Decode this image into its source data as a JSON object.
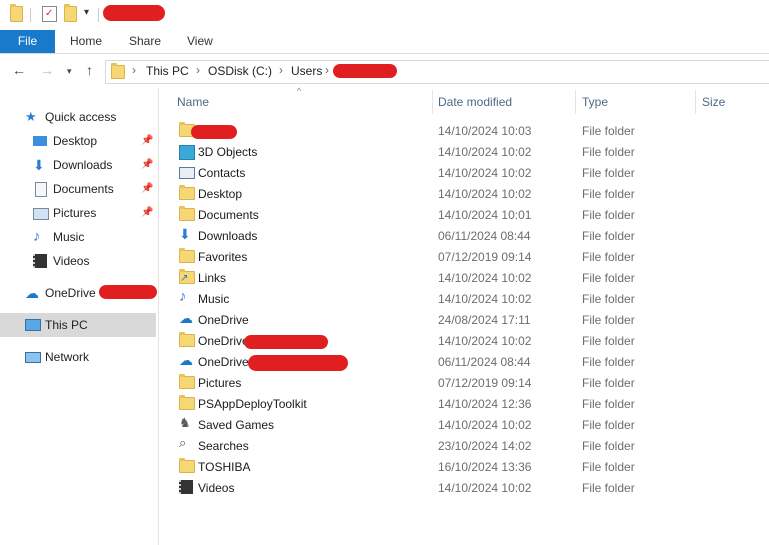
{
  "ribbon": {
    "file": "File",
    "home": "Home",
    "share": "Share",
    "view": "View"
  },
  "address": {
    "this_pc": "This PC",
    "drive": "OSDisk (C:)",
    "users": "Users"
  },
  "sidebar": {
    "quick_access": "Quick access",
    "items": [
      {
        "label": "Desktop",
        "icon": "desktop-icon",
        "pinned": true
      },
      {
        "label": "Downloads",
        "icon": "downloads-icon",
        "pinned": true
      },
      {
        "label": "Documents",
        "icon": "documents-icon",
        "pinned": true
      },
      {
        "label": "Pictures",
        "icon": "pictures-icon",
        "pinned": true
      },
      {
        "label": "Music",
        "icon": "music-icon",
        "pinned": false
      },
      {
        "label": "Videos",
        "icon": "videos-icon",
        "pinned": false
      }
    ],
    "onedrive": "OneDrive -",
    "this_pc": "This PC",
    "network": "Network"
  },
  "columns": {
    "name": "Name",
    "date": "Date modified",
    "type": "Type",
    "size": "Size"
  },
  "files": [
    {
      "name": "",
      "date": "14/10/2024 10:03",
      "type": "File folder",
      "icon": "folder-icon"
    },
    {
      "name": "3D Objects",
      "date": "14/10/2024 10:02",
      "type": "File folder",
      "icon": "3d-objects-icon"
    },
    {
      "name": "Contacts",
      "date": "14/10/2024 10:02",
      "type": "File folder",
      "icon": "contacts-icon"
    },
    {
      "name": "Desktop",
      "date": "14/10/2024 10:02",
      "type": "File folder",
      "icon": "folder-icon"
    },
    {
      "name": "Documents",
      "date": "14/10/2024 10:01",
      "type": "File folder",
      "icon": "folder-icon"
    },
    {
      "name": "Downloads",
      "date": "06/11/2024 08:44",
      "type": "File folder",
      "icon": "downloads-icon"
    },
    {
      "name": "Favorites",
      "date": "07/12/2019 09:14",
      "type": "File folder",
      "icon": "folder-icon"
    },
    {
      "name": "Links",
      "date": "14/10/2024 10:02",
      "type": "File folder",
      "icon": "links-icon"
    },
    {
      "name": "Music",
      "date": "14/10/2024 10:02",
      "type": "File folder",
      "icon": "music-icon"
    },
    {
      "name": "OneDrive",
      "date": "24/08/2024 17:11",
      "type": "File folder",
      "icon": "onedrive-icon"
    },
    {
      "name": "OneDrive",
      "date": "14/10/2024 10:02",
      "type": "File folder",
      "icon": "folder-icon"
    },
    {
      "name": "OneDrive",
      "date": "06/11/2024 08:44",
      "type": "File folder",
      "icon": "onedrive-icon"
    },
    {
      "name": "Pictures",
      "date": "07/12/2019 09:14",
      "type": "File folder",
      "icon": "folder-icon"
    },
    {
      "name": "PSAppDeployToolkit",
      "date": "14/10/2024 12:36",
      "type": "File folder",
      "icon": "folder-icon"
    },
    {
      "name": "Saved Games",
      "date": "14/10/2024 10:02",
      "type": "File folder",
      "icon": "saved-games-icon"
    },
    {
      "name": "Searches",
      "date": "23/10/2024 14:02",
      "type": "File folder",
      "icon": "searches-icon"
    },
    {
      "name": "TOSHIBA",
      "date": "16/10/2024 13:36",
      "type": "File folder",
      "icon": "folder-icon"
    },
    {
      "name": "Videos",
      "date": "14/10/2024 10:02",
      "type": "File folder",
      "icon": "videos-icon"
    }
  ]
}
